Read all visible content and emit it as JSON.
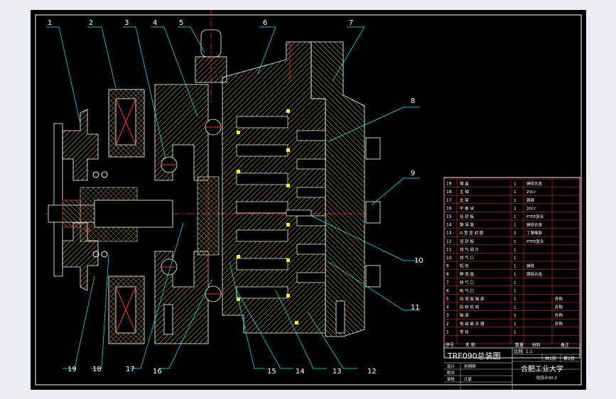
{
  "drawing": {
    "title": "TRF090总装图",
    "scale_label": "比例",
    "scale": "1:1",
    "school": "合肥工业大学",
    "drawing_no": "哈设计00-2",
    "designer_label": "设计",
    "checker_label": "校对",
    "reviewer_label": "审核",
    "designer_name": "刘明明",
    "reviewer_name": "江家",
    "sheet_label": "共1张",
    "sheet_no": "第1张",
    "colors": {
      "background": "#000000",
      "frame": "#ffffff",
      "hatch": "#d4c030",
      "leader": "#00ffff",
      "part_number": "#ffffff",
      "marker": "#ffff00",
      "accent": "#ff2020",
      "bom_grid": "#ff3030"
    }
  },
  "callouts": [
    "1",
    "2",
    "3",
    "4",
    "5",
    "6",
    "7",
    "8",
    "9",
    "10",
    "11",
    "12",
    "13",
    "14",
    "15",
    "16",
    "17",
    "18",
    "19"
  ],
  "bom": {
    "headers": {
      "no": "序号",
      "name": "名 称",
      "qty": "数量",
      "material": "材料",
      "note": "备注"
    },
    "rows": [
      {
        "no": "19",
        "name": "端 盖",
        "qty": "1",
        "material": "铸铝合金",
        "note": ""
      },
      {
        "no": "18",
        "name": "主 轴",
        "qty": "1",
        "material": "20Cr",
        "note": ""
      },
      {
        "no": "17",
        "name": "支 架",
        "qty": "1",
        "material": "铸铁",
        "note": ""
      },
      {
        "no": "16",
        "name": "平 衡 块",
        "qty": "2",
        "material": "20Cr",
        "note": ""
      },
      {
        "no": "15",
        "name": "径 封 板",
        "qty": "1",
        "material": "PTFE复合",
        "note": ""
      },
      {
        "no": "14",
        "name": "静 涡 旋",
        "qty": "1",
        "material": "铸铝合金",
        "note": ""
      },
      {
        "no": "13",
        "name": "O 型 密 封 圈",
        "qty": "2",
        "material": "丁腈橡胶",
        "note": ""
      },
      {
        "no": "12",
        "name": "径 封 板",
        "qty": "1",
        "material": "PTFE复合",
        "note": ""
      },
      {
        "no": "11",
        "name": "排 气 阀 片",
        "qty": "1",
        "material": "",
        "note": ""
      },
      {
        "no": "10",
        "name": "排 气 口",
        "qty": "1",
        "material": "",
        "note": ""
      },
      {
        "no": "9",
        "name": "机 壳",
        "qty": "1",
        "material": "铸铁",
        "note": ""
      },
      {
        "no": "8",
        "name": "静 涡 旋",
        "qty": "1",
        "material": "铸铝合金",
        "note": ""
      },
      {
        "no": "7",
        "name": "排 气 口",
        "qty": "1",
        "material": "",
        "note": ""
      },
      {
        "no": "6",
        "name": "吸 气 口",
        "qty": "1",
        "material": "",
        "note": ""
      },
      {
        "no": "5",
        "name": "动 涡 旋 轴 承",
        "qty": "1",
        "material": "",
        "note": "外购"
      },
      {
        "no": "4",
        "name": "防 转 机 构",
        "qty": "1",
        "material": "",
        "note": "外购"
      },
      {
        "no": "3",
        "name": "轴 承",
        "qty": "1",
        "material": "",
        "note": "外购"
      },
      {
        "no": "2",
        "name": "电 磁 离 合 器",
        "qty": "1",
        "material": "",
        "note": "外购"
      },
      {
        "no": "1",
        "name": "带 轮",
        "qty": "1",
        "material": "",
        "note": ""
      }
    ]
  }
}
